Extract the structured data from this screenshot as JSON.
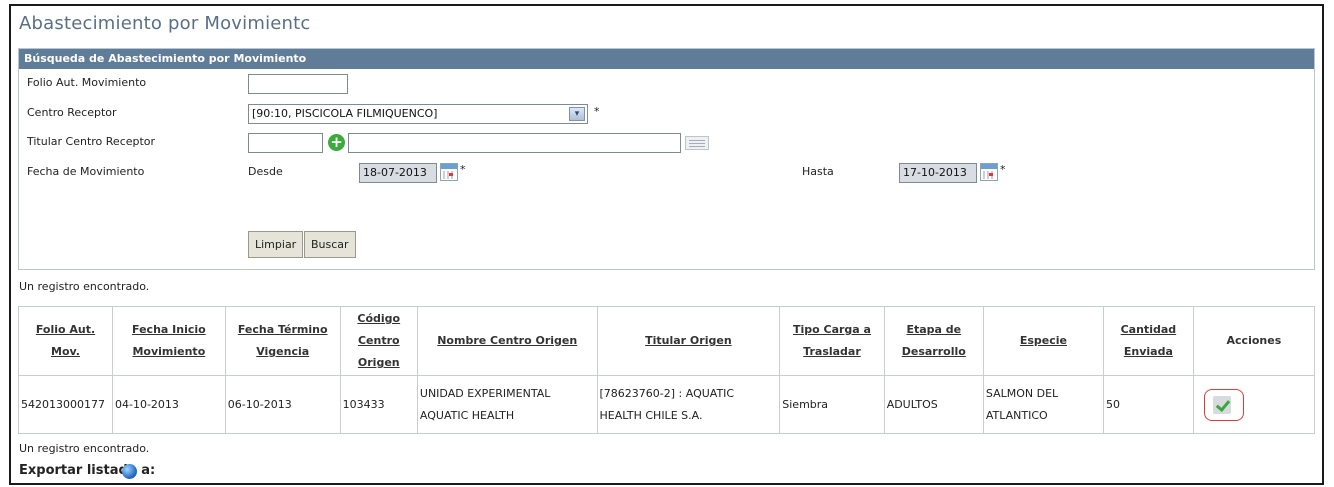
{
  "page_title": "Abastecimiento por Movimientc",
  "search_panel": {
    "header": "Búsqueda de Abastecimiento por Movimiento",
    "folio_label": "Folio Aut. Movimiento",
    "folio_value": "",
    "centro_label": "Centro Receptor",
    "centro_value": "[90:10, PISCICOLA FILMIQUENCO]",
    "titular_label": "Titular Centro Receptor",
    "titular_rut": "",
    "titular_name": "",
    "fecha_label": "Fecha de Movimiento",
    "desde_label": "Desde",
    "desde_value": "18-07-2013",
    "hasta_label": "Hasta",
    "hasta_value": "17-10-2013",
    "required_mark": "*",
    "limpiar_label": "Limpiar",
    "buscar_label": "Buscar"
  },
  "result_count_text": "Un registro encontrado.",
  "table": {
    "headers": [
      [
        "Folio Aut.",
        "Mov."
      ],
      [
        "Fecha Inicio",
        "Movimiento"
      ],
      [
        "Fecha Término",
        "Vigencia"
      ],
      [
        "Código Centro",
        "Origen"
      ],
      [
        "Nombre Centro Origen"
      ],
      [
        "Titular Origen"
      ],
      [
        "Tipo Carga a",
        "Trasladar"
      ],
      [
        "Etapa de",
        "Desarrollo"
      ],
      [
        "Especie"
      ],
      [
        "Cantidad",
        "Enviada"
      ],
      [
        "Acciones"
      ]
    ],
    "rows": [
      {
        "folio": "542013000177",
        "fecha_inicio": "04-10-2013",
        "fecha_termino": "06-10-2013",
        "codigo": "103433",
        "nombre_1": "UNIDAD EXPERIMENTAL",
        "nombre_2": "AQUATIC HEALTH",
        "titular_1": "[78623760-2] : AQUATIC",
        "titular_2": "HEALTH CHILE S.A.",
        "tipo_carga": "Siembra",
        "etapa": "ADULTOS",
        "especie_1": "SALMON DEL",
        "especie_2": "ATLANTICO",
        "cantidad": "50"
      }
    ]
  },
  "export_label": "Exportar listado a:"
}
